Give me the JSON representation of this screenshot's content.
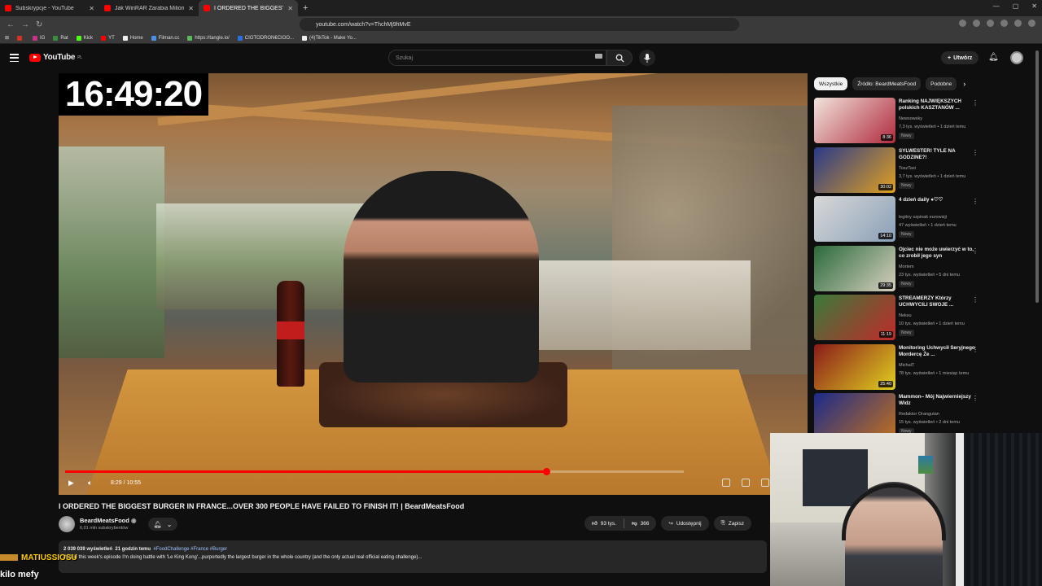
{
  "browser": {
    "tabs": [
      {
        "label": "Subskrypcje - YouTube",
        "active": false
      },
      {
        "label": "Jak WinRAR Zarabia Miliony na bycie...",
        "active": false
      },
      {
        "label": "I ORDERED THE BIGGEST BURGER...",
        "active": true
      }
    ],
    "url": "youtube.com/watch?v=ThchMj9hMvE",
    "bookmarks": [
      {
        "label": "",
        "color": "#d93025"
      },
      {
        "label": "IG",
        "color": "#c13584"
      },
      {
        "label": "Rat",
        "color": "#3a8d3a"
      },
      {
        "label": "Kick",
        "color": "#53fc18"
      },
      {
        "label": "YT",
        "color": "#ff0000"
      },
      {
        "label": "Home",
        "color": "#eeeeee"
      },
      {
        "label": "Filman.cc",
        "color": "#4a90e2"
      },
      {
        "label": "https://tangle.io/",
        "color": "#5cb85c"
      },
      {
        "label": "CIOTODRON€CIOO...",
        "color": "#2a6fdb"
      },
      {
        "label": "(4)TikTok - Make Yo...",
        "color": "#eeeeee"
      }
    ]
  },
  "youtube": {
    "logo_text": "YouTube",
    "region": "PL",
    "search_placeholder": "Szukaj",
    "create_label": "Utwórz"
  },
  "player": {
    "overlay_timestamp": "16:49:20",
    "time_display": "8:29 / 10:55",
    "progress_fraction": 0.777
  },
  "video": {
    "title": "I ORDERED THE BIGGEST BURGER IN FRANCE...OVER 300 PEOPLE HAVE FAILED TO FINISH IT! | BeardMeatsFood",
    "channel_name": "BeardMeatsFood",
    "channel_subs": "6,01 mln subskrybentów",
    "likes": "93 tys.",
    "dislikes": "366",
    "share_label": "Udostępnij",
    "save_label": "Zapisz",
    "desc_views": "2 039 039 wyświetleń",
    "desc_age": "21 godzin temu",
    "desc_tags": "#FoodChallenge #France #Burger",
    "desc_text": "And in this week's episode I'm doing battle with 'Le King Kong'...purportedly the largest burger in the whole country (and the only actual real official eating challenge)..."
  },
  "sidebar": {
    "chips": [
      "Wszystkie",
      "Źródło: BeardMeatsFood",
      "Podobne"
    ],
    "recommendations": [
      {
        "title": "Ranking NAJWIĘKSZYCH polskich KASZTANÓW ...",
        "channel": "Newsowsky",
        "meta": "7,3 tys. wyświetleń • 1 dzień temu",
        "badge": "Nowy",
        "duration": "8:36",
        "colors": [
          "#f2e4dc",
          "#b02a3d"
        ]
      },
      {
        "title": "SYLWESTER! TYLE NA GODZINE?!",
        "channel": "ToszTaxi",
        "meta": "3,7 tys. wyświetleń • 1 dzień temu",
        "badge": "Nowy",
        "duration": "30:02",
        "colors": [
          "#2a3a8a",
          "#e0a020"
        ]
      },
      {
        "title": "4 dzień daily ●♡♡",
        "channel": "legitny szpinak eurowizji",
        "meta": "47 wyświetleń • 1 dzień temu",
        "badge": "Nowy",
        "duration": "14:10",
        "colors": [
          "#d8d8d8",
          "#8aa0b8"
        ]
      },
      {
        "title": "Ojciec nie może uwierzyć w to, co zrobił jego syn",
        "channel": "Mortem",
        "meta": "23 tys. wyświetleń • 5 dni temu",
        "badge": "Nowy",
        "duration": "29:35",
        "colors": [
          "#2a6a3a",
          "#d8d0c0"
        ]
      },
      {
        "title": "STREAMERZY Którzy UCHWYCILI SWOJE ...",
        "channel": "Neksu",
        "meta": "10 tys. wyświetleń • 1 dzień temu",
        "badge": "Nowy",
        "duration": "11:19",
        "colors": [
          "#3a7a3a",
          "#c02a2a"
        ]
      },
      {
        "title": "Monitoring Uchwycił Seryjnego Mordercę Że ...",
        "channel": "MichalT",
        "meta": "78 tys. wyświetleń • 1 miesiąc temu",
        "badge": "",
        "duration": "25:40",
        "colors": [
          "#8a1a1a",
          "#e0d020"
        ]
      },
      {
        "title": "Mammon– Mój Najwierniejszy Widz",
        "channel": "Redaktor Orangutan",
        "meta": "15 tys. wyświetleń • 2 dni temu",
        "badge": "Nowy",
        "duration": "",
        "colors": [
          "#1a2a8a",
          "#c07020"
        ]
      }
    ]
  },
  "stream_overlay": {
    "name_tag": "MATIUSSIOSU",
    "chat_caption": "kilo mefy"
  }
}
